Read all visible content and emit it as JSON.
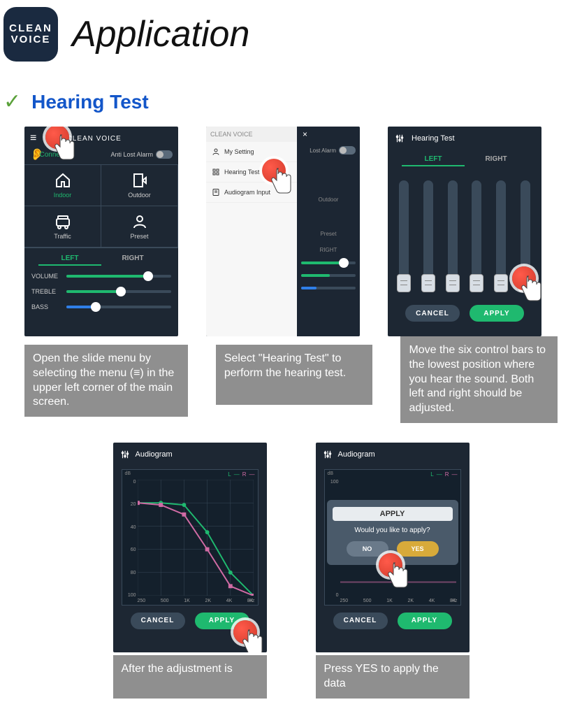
{
  "logo": {
    "line1": "CLEAN",
    "line2": "VOICE"
  },
  "page_title": "Application",
  "section_title": "Hearing Test",
  "phone1": {
    "app_name": "CLEAN VOICE",
    "status": "Connected",
    "anti_lost_label": "Anti Lost Alarm",
    "modes": {
      "indoor": "Indoor",
      "outdoor": "Outdoor",
      "traffic": "Traffic",
      "preset": "Preset"
    },
    "tab_left": "LEFT",
    "tab_right": "RIGHT",
    "sliders": {
      "volume": {
        "label": "VOLUME",
        "fill_pct": 78,
        "color": "#1fb96f"
      },
      "treble": {
        "label": "TREBLE",
        "fill_pct": 52,
        "color": "#1fb96f"
      },
      "bass": {
        "label": "BASS",
        "fill_pct": 28,
        "color": "#2f7fe8"
      }
    }
  },
  "phone2": {
    "header_title": "CLEAN VOICE",
    "close": "×",
    "menu": {
      "my_setting": "My Setting",
      "hearing_test": "Hearing Test",
      "audiogram_input": "Audiogram Input"
    },
    "right_panel": {
      "lost_alarm": "Lost Alarm",
      "outdoor": "Outdoor",
      "preset": "Preset",
      "tab_right": "RIGHT"
    }
  },
  "phone3": {
    "title": "Hearing Test",
    "tab_left": "LEFT",
    "tab_right": "RIGHT",
    "knob_bottoms": [
      134,
      134,
      134,
      134,
      134,
      134
    ],
    "cancel": "CANCEL",
    "apply": "APPLY"
  },
  "phone4": {
    "title": "Audiogram",
    "cancel": "CANCEL",
    "apply": "APPLY",
    "legend": {
      "l": "L",
      "r": "R",
      "dash": "—"
    },
    "db_label": "dB",
    "hz_label": "Hz"
  },
  "phone5": {
    "title": "Audiogram",
    "cancel": "CANCEL",
    "apply": "APPLY",
    "legend": {
      "l": "L",
      "r": "R",
      "dash": "—"
    },
    "db_label": "dB",
    "hz_label": "Hz",
    "modal": {
      "title": "APPLY",
      "text": "Would you like to apply?",
      "no": "NO",
      "yes": "YES"
    }
  },
  "chart_data": {
    "type": "line",
    "title": "Audiogram",
    "xlabel": "Hz",
    "ylabel": "dB",
    "x_ticks": [
      "250",
      "500",
      "1K",
      "2K",
      "4K",
      "8K"
    ],
    "y_ticks": [
      "0",
      "20",
      "40",
      "60",
      "80",
      "100"
    ],
    "ylim": [
      0,
      100
    ],
    "series": [
      {
        "name": "L",
        "x": [
          "250",
          "500",
          "1K",
          "2K",
          "4K",
          "8K"
        ],
        "values": [
          20,
          20,
          22,
          45,
          80,
          100
        ],
        "color": "#1fb96f"
      },
      {
        "name": "R",
        "x": [
          "250",
          "500",
          "1K",
          "2K",
          "4K",
          "8K"
        ],
        "values": [
          20,
          22,
          30,
          60,
          92,
          100
        ],
        "color": "#d16ba5"
      }
    ]
  },
  "captions": {
    "c1": "Open the slide menu by selecting the menu (≡) in the upper left corner of the main screen.",
    "c2": "Select \"Hearing Test\" to perform the hearing test.",
    "c3": "Move the six control bars to the lowest position where you hear the sound. Both left and right should be adjusted.",
    "c4": "After the adjustment is",
    "c5": "Press YES to apply the data"
  }
}
